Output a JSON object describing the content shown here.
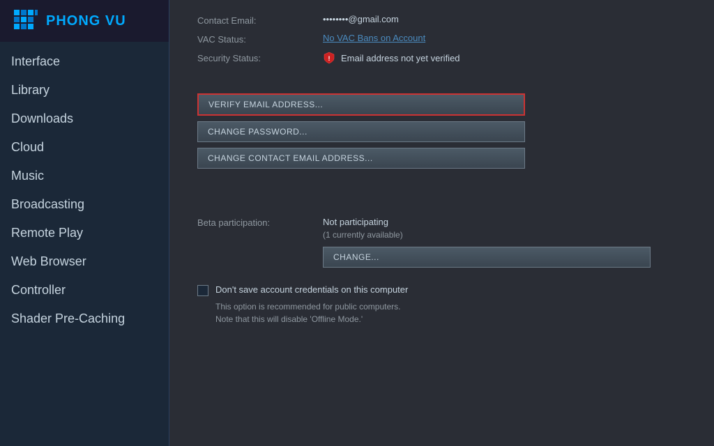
{
  "logo": {
    "text": "PHONG VU"
  },
  "sidebar": {
    "items": [
      {
        "label": "Interface",
        "active": false
      },
      {
        "label": "Library",
        "active": false
      },
      {
        "label": "Downloads",
        "active": false
      },
      {
        "label": "Cloud",
        "active": false
      },
      {
        "label": "Music",
        "active": false
      },
      {
        "label": "Broadcasting",
        "active": false
      },
      {
        "label": "Remote Play",
        "active": false
      },
      {
        "label": "Web Browser",
        "active": false
      },
      {
        "label": "Controller",
        "active": false
      },
      {
        "label": "Shader Pre-Caching",
        "active": false
      }
    ]
  },
  "content": {
    "contact_email_label": "Contact Email:",
    "contact_email_value": "••••••••@gmail.com",
    "vac_status_label": "VAC Status:",
    "vac_status_link": "No VAC Bans on Account",
    "security_status_label": "Security Status:",
    "security_status_text": "Email address not yet verified",
    "btn_verify": "VERIFY EMAIL ADDRESS...",
    "btn_change_password": "CHANGE PASSWORD...",
    "btn_change_email": "CHANGE CONTACT EMAIL ADDRESS...",
    "beta_label": "Beta participation:",
    "beta_value": "Not participating",
    "beta_sub": "(1 currently available)",
    "btn_change": "CHANGE...",
    "checkbox_label": "Don't save account credentials on this computer",
    "checkbox_note_line1": "This option is recommended for public computers.",
    "checkbox_note_line2": "Note that this will disable 'Offline Mode.'"
  }
}
